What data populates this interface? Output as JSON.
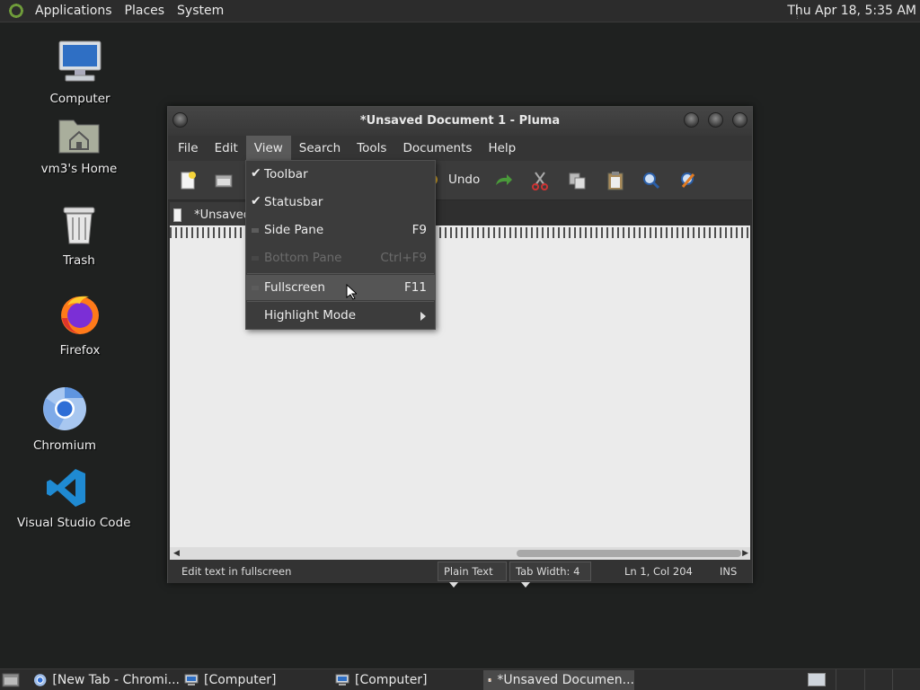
{
  "top_panel": {
    "menus": [
      "Applications",
      "Places",
      "System"
    ],
    "clock": "Thu Apr 18,  5:35 AM"
  },
  "desktop_icons": [
    {
      "label": "Computer",
      "icon": "computer-icon"
    },
    {
      "label": "vm3's Home",
      "icon": "home-folder-icon"
    },
    {
      "label": "Trash",
      "icon": "trash-icon"
    },
    {
      "label": "Firefox",
      "icon": "firefox-icon"
    },
    {
      "label": "Chromium",
      "icon": "chromium-icon"
    },
    {
      "label": "Visual Studio Code",
      "icon": "vscode-icon"
    }
  ],
  "window": {
    "title": "*Unsaved Document 1 - Pluma",
    "menubar": [
      "File",
      "Edit",
      "View",
      "Search",
      "Tools",
      "Documents",
      "Help"
    ],
    "active_menu": "View",
    "toolbar": {
      "undo_label": "Undo",
      "icons": [
        "new-document-icon",
        "open-icon",
        "redo-icon",
        "cut-icon",
        "copy-icon",
        "paste-icon",
        "find-icon",
        "replace-icon"
      ]
    },
    "tab_label": "*Unsaved",
    "statusbar": {
      "message": "Edit text in fullscreen",
      "language": "Plain Text",
      "tab_width": "Tab Width:  4",
      "position": "Ln 1, Col 204",
      "mode": "INS"
    }
  },
  "view_menu": {
    "items": [
      {
        "label": "Toolbar",
        "shortcut": "",
        "checked": true
      },
      {
        "label": "Statusbar",
        "shortcut": "",
        "checked": true
      },
      {
        "label": "Side Pane",
        "shortcut": "F9",
        "checked": false
      },
      {
        "label": "Bottom Pane",
        "shortcut": "Ctrl+F9",
        "checked": false,
        "disabled": true
      },
      {
        "label": "Fullscreen",
        "shortcut": "F11",
        "checked": false,
        "highlighted": true
      },
      {
        "label": "Highlight Mode",
        "shortcut": "",
        "submenu": true
      }
    ]
  },
  "taskbar": {
    "tasks": [
      "[New Tab - Chromi...",
      "[Computer]",
      "[Computer]",
      "*Unsaved Documen..."
    ]
  }
}
